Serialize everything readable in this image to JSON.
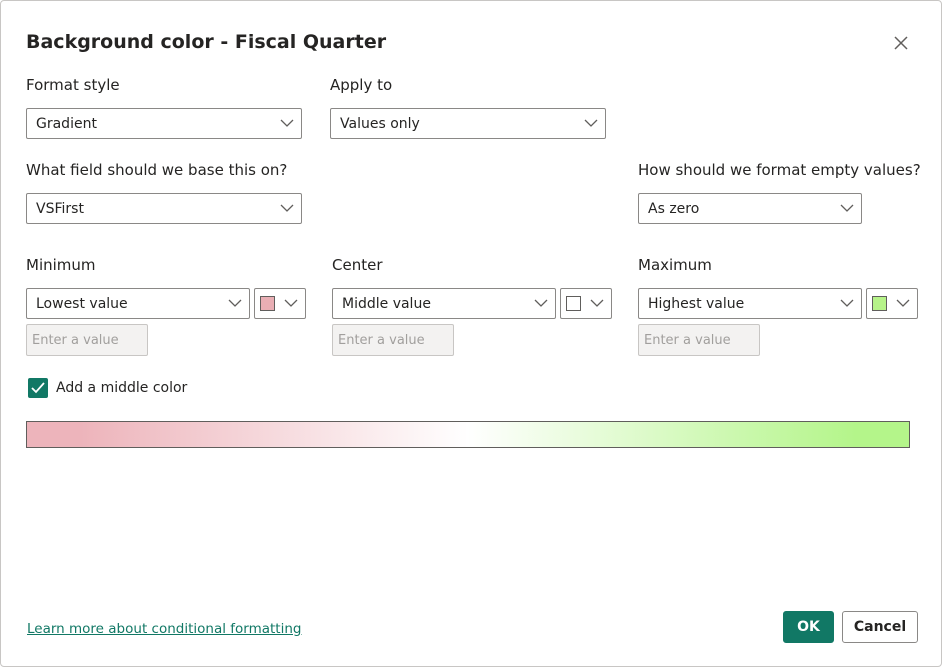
{
  "dialog": {
    "title": "Background color - Fiscal Quarter",
    "close_icon": "close-icon"
  },
  "format_style": {
    "label": "Format style",
    "value": "Gradient"
  },
  "apply_to": {
    "label": "Apply to",
    "value": "Values only"
  },
  "base_field": {
    "label": "What field should we base this on?",
    "value": "VSFirst"
  },
  "empty_values": {
    "label": "How should we format empty values?",
    "value": "As zero"
  },
  "minimum": {
    "label": "Minimum",
    "value": "Lowest value",
    "color": "#e9aeb4",
    "placeholder": "Enter a value"
  },
  "center": {
    "label": "Center",
    "value": "Middle value",
    "color": "#ffffff",
    "placeholder": "Enter a value"
  },
  "maximum": {
    "label": "Maximum",
    "value": "Highest value",
    "color": "#b6f389",
    "placeholder": "Enter a value"
  },
  "middle_color": {
    "label": "Add a middle color",
    "checked": true
  },
  "gradient": {
    "min_color": "#edb4bb",
    "mid_color": "#ffffff",
    "max_color": "#b4f58a"
  },
  "footer": {
    "link": "Learn more about conditional formatting",
    "ok": "OK",
    "cancel": "Cancel"
  },
  "icons": {
    "chevron": "chevron-down-icon",
    "check": "checkmark-icon"
  }
}
